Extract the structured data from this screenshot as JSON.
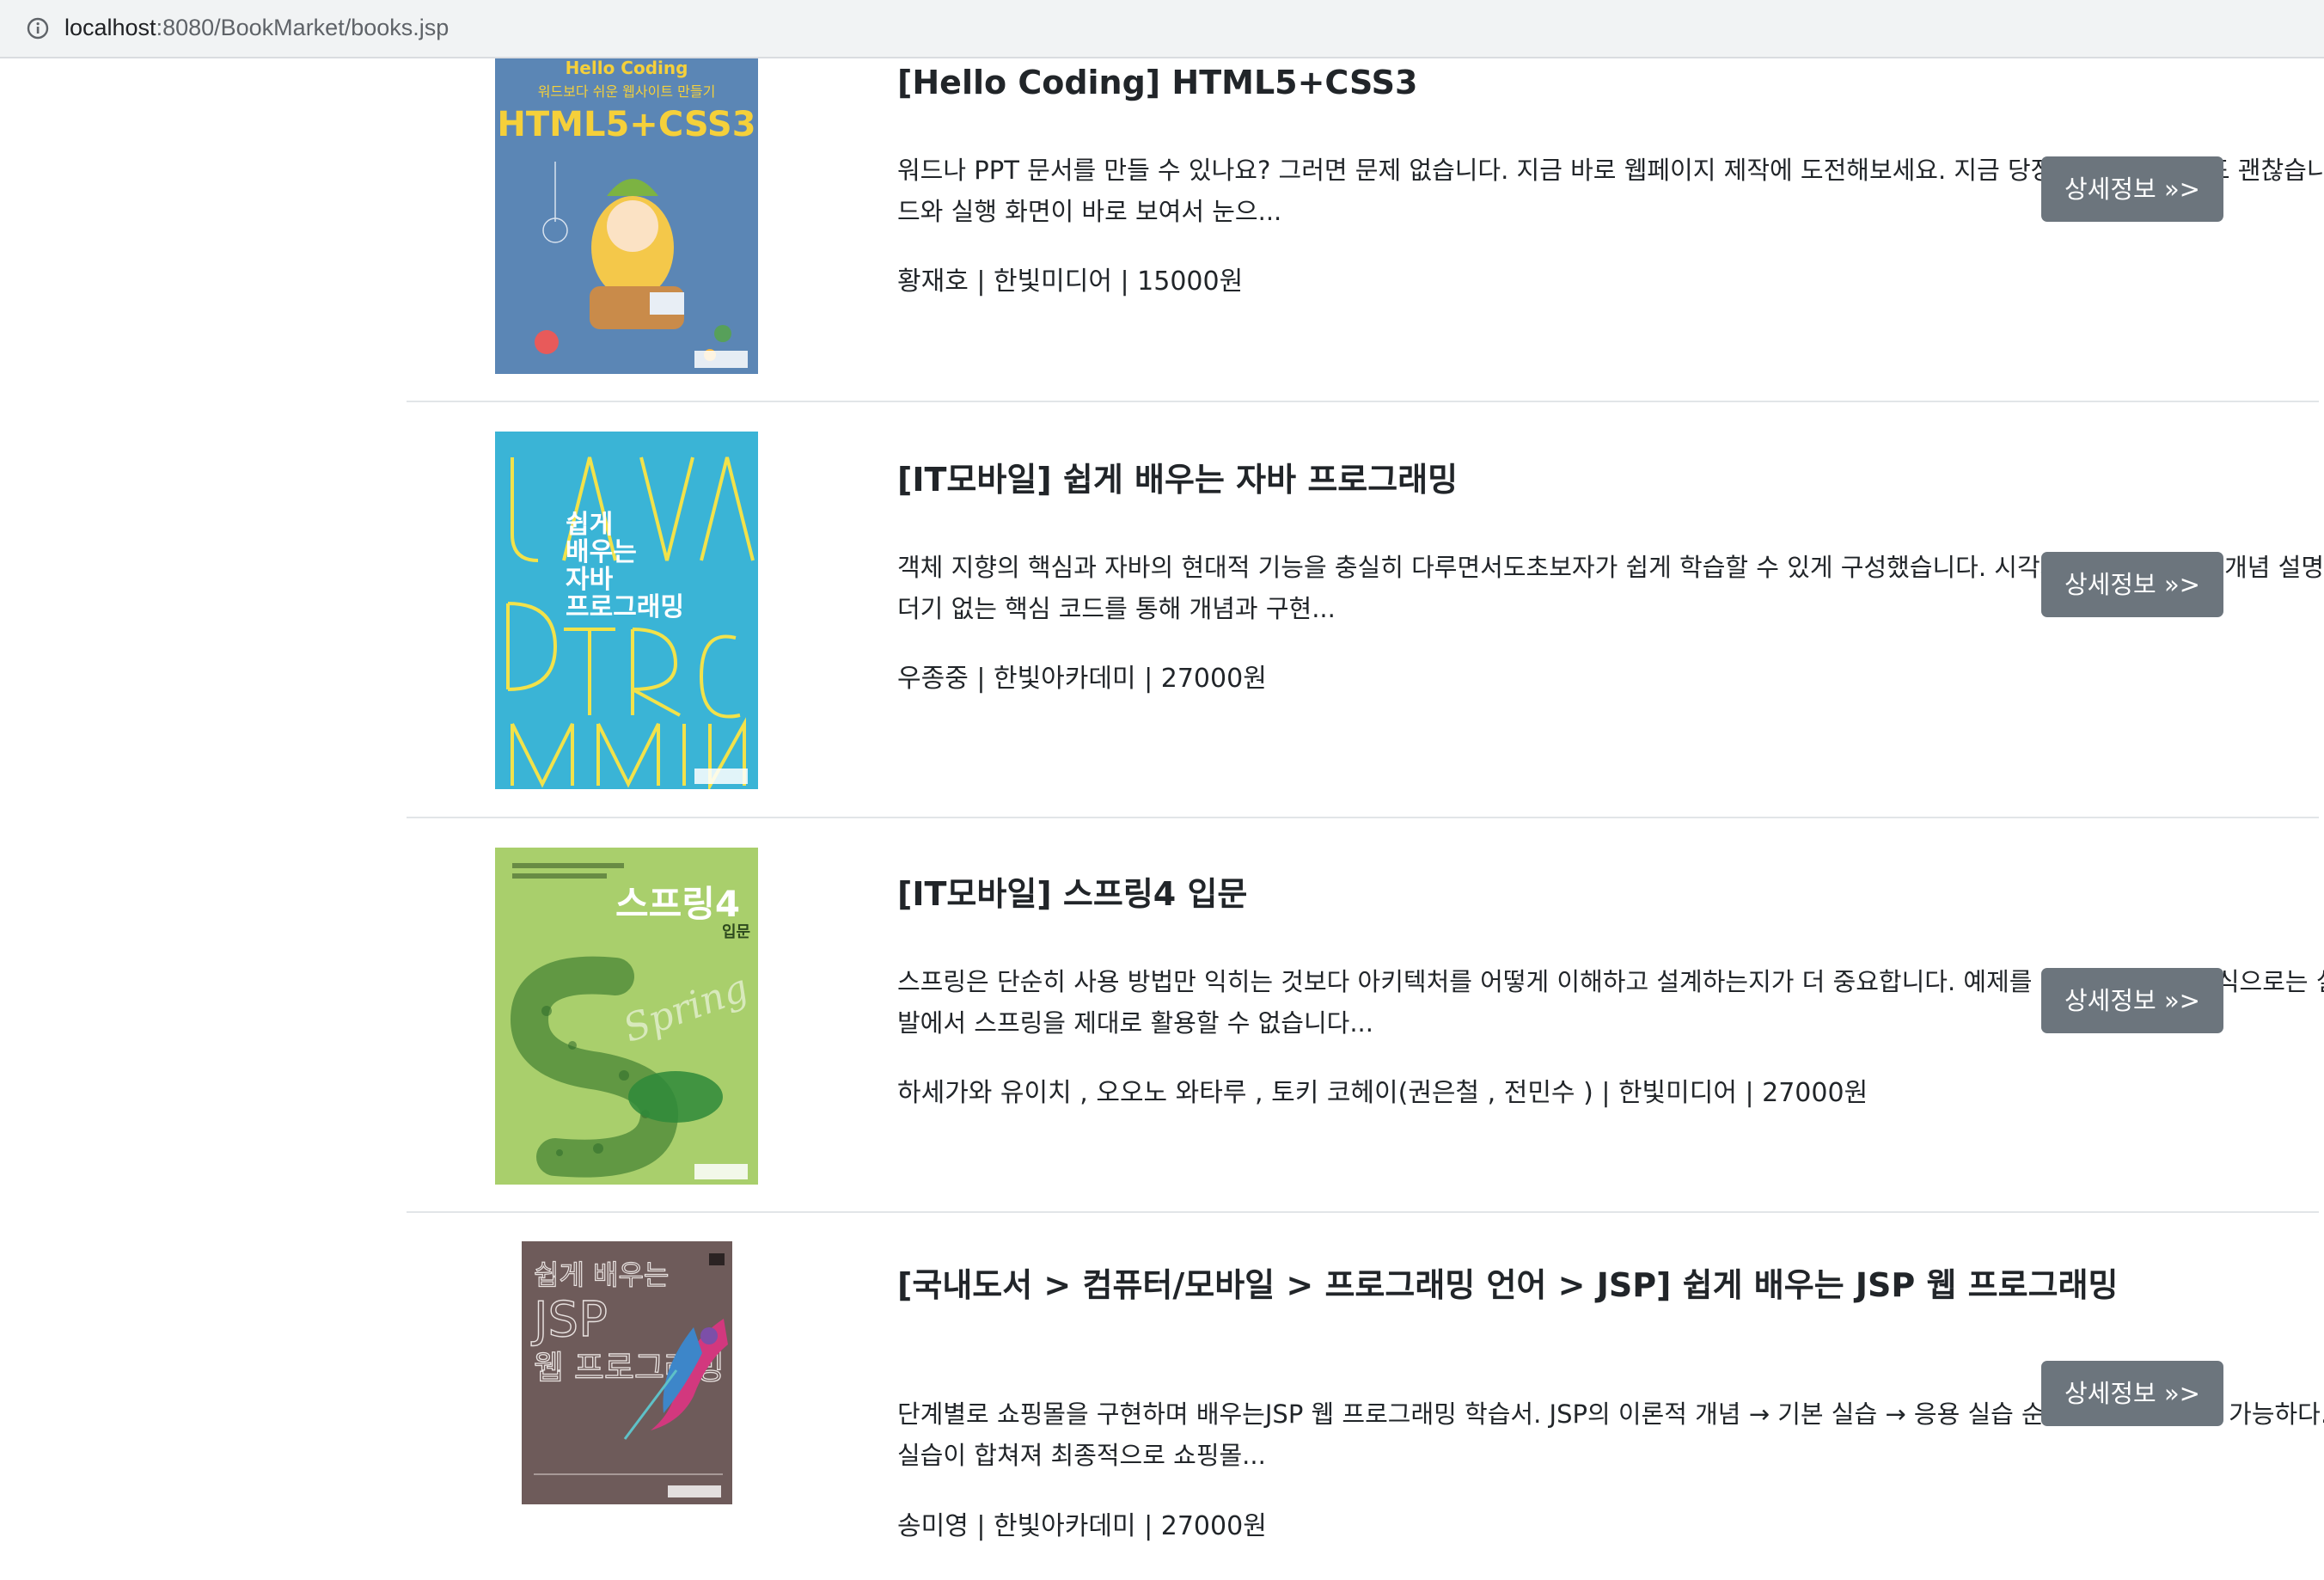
{
  "browser": {
    "url_host": "localhost",
    "url_path": ":8080/BookMarket/books.jsp"
  },
  "books": [
    {
      "title": "[Hello Coding] HTML5+CSS3",
      "description": "워드나 PPT 문서를 만들 수 있나요? 그러면 문제 없습니다. 지금 바로 웹페이지 제작에 도전해보세요. 지금 당장 컴퓨터가 없어도 괜찮습니다. 코드와 실행 화면이 바로 보여서 눈으...",
      "meta": "황재호 | 한빛미디어 | 15000원",
      "button": "상세정보 »>",
      "cover": {
        "line1": "Hello Coding",
        "line2": "워드보다 쉬운 웹사이트 만들기",
        "line3": "HTML5+CSS3",
        "bg": "#5b86b5"
      }
    },
    {
      "title": "[IT모바일] 쉽게 배우는 자바 프로그래밍",
      "description": "객체 지향의 핵심과 자바의 현대적 기능을 충실히 다루면서도초보자가 쉽게 학습할 수 있게 구성했습니다. 시각화 도구를 활용한 개념 설명과 군더더기 없는 핵심 코드를 통해 개념과 구현...",
      "meta": "우종중 | 한빛아카데미 | 27000원",
      "button": "상세정보 »>",
      "cover": {
        "line1": "쉽게",
        "line2": "배우는",
        "line3": "자바",
        "line4": "프로그래밍",
        "bg": "#3ab4d6"
      }
    },
    {
      "title": "[IT모바일] 스프링4 입문",
      "description": "스프링은 단순히 사용 방법만 익히는 것보다 아키텍처를 어떻게 이해하고 설계하는지가 더 중요합니다. 예제를 복사해 붙여넣는 식으로는 실제 개발에서 스프링을 제대로 활용할 수 없습니다...",
      "meta": "하세가와 유이치 , 오오노 와타루 , 토키 코헤이(권은철 , 전민수 ) | 한빛미디어 | 27000원",
      "button": "상세정보 »>",
      "cover": {
        "line1": "스프링4",
        "line2": "입문",
        "line3": "Spring",
        "bg": "#a9cf6c"
      }
    },
    {
      "title": "[국내도서 > 컴퓨터/모바일 > 프로그래밍 언어 > JSP] 쉽게 배우는 JSP 웹 프로그래밍",
      "description": "단계별로 쇼핑몰을 구현하며 배우는JSP 웹 프로그래밍 학습서. JSP의 이론적 개념 → 기본 실습 → 응용 실습 순의 단계별 학습이 가능하다. 응용 실습이 합쳐져 최종적으로 쇼핑몰...",
      "meta": "송미영 | 한빛아카데미 | 27000원",
      "button": "상세정보 »>",
      "cover": {
        "line1": "쉽게 배우는",
        "line2": "JSP",
        "line3": "웹 프로그래밍",
        "bg": "#6e5b5a"
      }
    }
  ]
}
